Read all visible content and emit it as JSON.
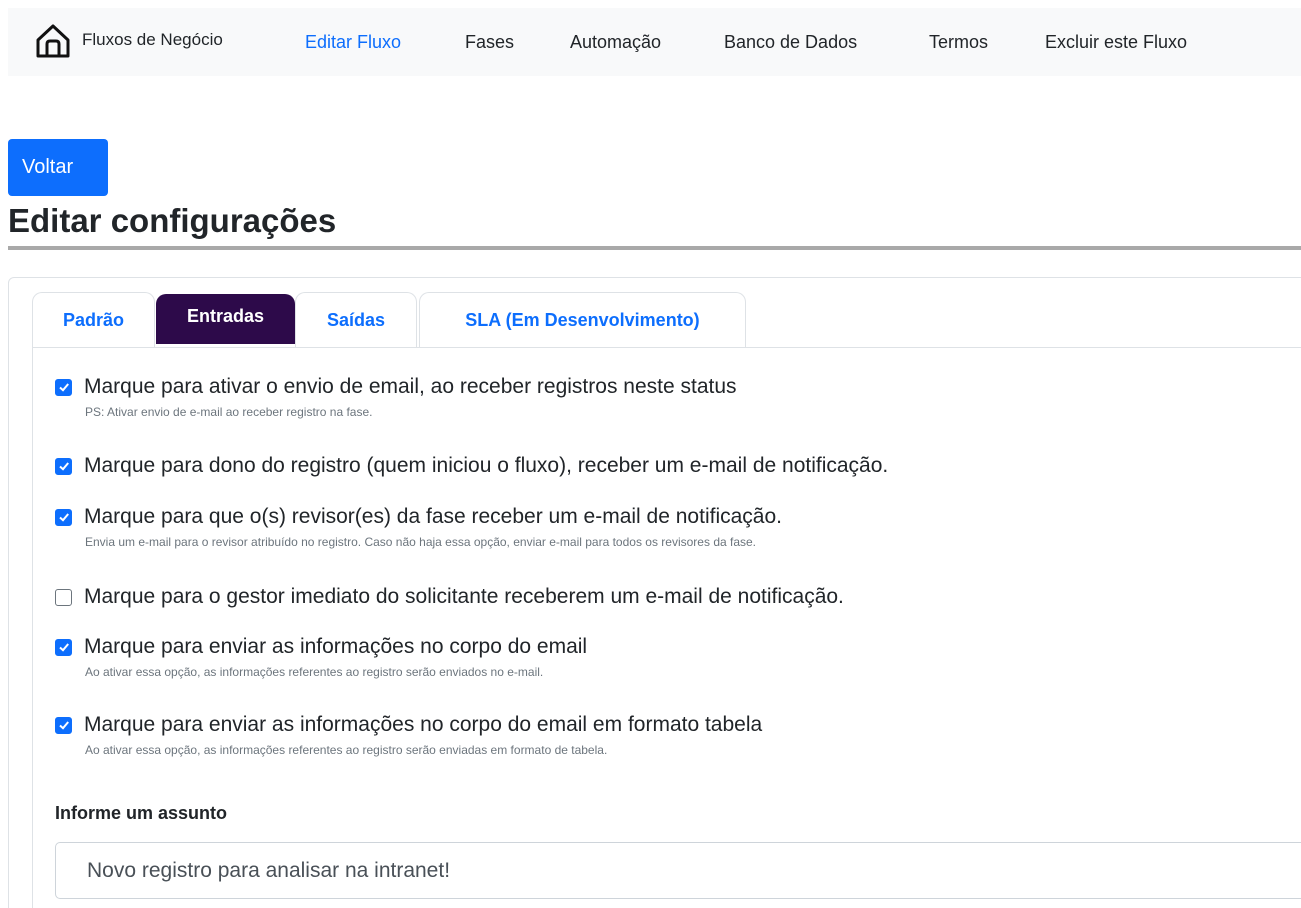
{
  "nav": {
    "items": [
      {
        "label": "Fluxos de Negócio",
        "active": false
      },
      {
        "label": "Editar Fluxo",
        "active": true
      },
      {
        "label": "Fases",
        "active": false
      },
      {
        "label": "Automação",
        "active": false
      },
      {
        "label": "Banco de Dados",
        "active": false
      },
      {
        "label": "Termos",
        "active": false
      },
      {
        "label": "Excluir este Fluxo",
        "active": false
      }
    ],
    "home_icon": "home-icon"
  },
  "back_button": "Voltar",
  "page_title": "Editar configurações",
  "tabs": [
    {
      "label": "Padrão",
      "active": false
    },
    {
      "label": "Entradas",
      "active": true
    },
    {
      "label": "Saídas",
      "active": false
    },
    {
      "label": "SLA (Em Desenvolvimento)",
      "active": false
    }
  ],
  "options": [
    {
      "label": "Marque para ativar o envio de email, ao receber registros neste status",
      "hint": "PS: Ativar envio de e-mail ao receber registro na fase.",
      "checked": true
    },
    {
      "label": "Marque para dono do registro (quem iniciou o fluxo), receber um e-mail de notificação.",
      "hint": "",
      "checked": true
    },
    {
      "label": "Marque para que o(s) revisor(es) da fase receber um e-mail de notificação.",
      "hint": "Envia um e-mail para o revisor atribuído no registro. Caso não haja essa opção, enviar e-mail para todos os revisores da fase.",
      "checked": true
    },
    {
      "label": "Marque para o gestor imediato do solicitante receberem um e-mail de notificação.",
      "hint": "",
      "checked": false
    },
    {
      "label": "Marque para enviar as informações no corpo do email",
      "hint": "Ao ativar essa opção, as informações referentes ao registro serão enviados no e-mail.",
      "checked": true
    },
    {
      "label": "Marque para enviar as informações no corpo do email em formato tabela",
      "hint": "Ao ativar essa opção, as informações referentes ao registro serão enviadas em formato de tabela.",
      "checked": true
    }
  ],
  "subject": {
    "label": "Informe um assunto",
    "value": "Novo registro para analisar na intranet!"
  },
  "colors": {
    "primary": "#0d6efd",
    "active_tab": "#2d0a4a",
    "nav_bg": "#f8f9fa"
  }
}
